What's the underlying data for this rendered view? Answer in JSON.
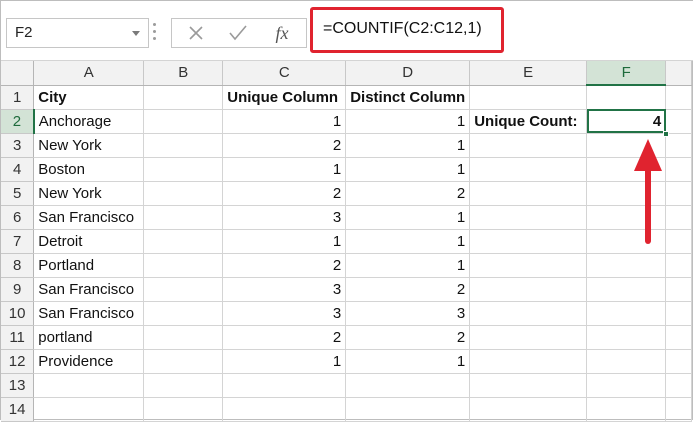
{
  "formula_bar": {
    "name_box": "F2",
    "formula": "=COUNTIF(C2:C12,1)",
    "fx_label": "fx"
  },
  "columns": [
    "A",
    "B",
    "C",
    "D",
    "E",
    "F"
  ],
  "rows": [
    {
      "num": "1",
      "A": "City",
      "B": "",
      "C": "Unique Column",
      "D": "Distinct Column",
      "E": "",
      "F": ""
    },
    {
      "num": "2",
      "A": "Anchorage",
      "B": "",
      "C": "1",
      "D": "1",
      "E": "Unique Count:",
      "F": "4"
    },
    {
      "num": "3",
      "A": "New York",
      "B": "",
      "C": "2",
      "D": "1",
      "E": "",
      "F": ""
    },
    {
      "num": "4",
      "A": "Boston",
      "B": "",
      "C": "1",
      "D": "1",
      "E": "",
      "F": ""
    },
    {
      "num": "5",
      "A": "New York",
      "B": "",
      "C": "2",
      "D": "2",
      "E": "",
      "F": ""
    },
    {
      "num": "6",
      "A": "San Francisco",
      "B": "",
      "C": "3",
      "D": "1",
      "E": "",
      "F": ""
    },
    {
      "num": "7",
      "A": "Detroit",
      "B": "",
      "C": "1",
      "D": "1",
      "E": "",
      "F": ""
    },
    {
      "num": "8",
      "A": "Portland",
      "B": "",
      "C": "2",
      "D": "1",
      "E": "",
      "F": ""
    },
    {
      "num": "9",
      "A": "San Francisco",
      "B": "",
      "C": "3",
      "D": "2",
      "E": "",
      "F": ""
    },
    {
      "num": "10",
      "A": "San Francisco",
      "B": "",
      "C": "3",
      "D": "3",
      "E": "",
      "F": ""
    },
    {
      "num": "11",
      "A": "portland",
      "B": "",
      "C": "2",
      "D": "2",
      "E": "",
      "F": ""
    },
    {
      "num": "12",
      "A": "Providence",
      "B": "",
      "C": "1",
      "D": "1",
      "E": "",
      "F": ""
    },
    {
      "num": "13",
      "A": "",
      "B": "",
      "C": "",
      "D": "",
      "E": "",
      "F": ""
    },
    {
      "num": "14",
      "A": "",
      "B": "",
      "C": "",
      "D": "",
      "E": "",
      "F": ""
    }
  ],
  "selection": {
    "cell": "F2"
  },
  "colors": {
    "accent": "#217346",
    "highlight": "#e0232f"
  },
  "icons": [
    "cancel-icon",
    "enter-icon",
    "insert-function-icon",
    "name-box-dropdown-icon"
  ]
}
